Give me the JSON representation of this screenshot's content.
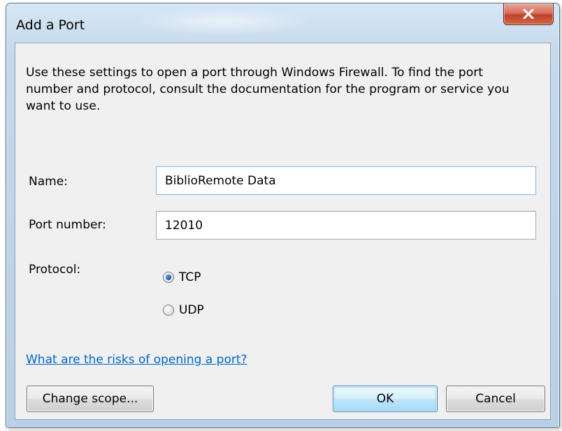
{
  "window": {
    "title": "Add a Port",
    "close_icon": "close-x-icon"
  },
  "dialog": {
    "description": "Use these settings to open a port through Windows Firewall. To find the port number and protocol, consult the documentation for the program or service you want to use.",
    "name_label": "Name:",
    "name_value": "BiblioRemote Data",
    "port_label": "Port number:",
    "port_value": "12010",
    "protocol_label": "Protocol:",
    "protocol_options": [
      {
        "label": "TCP",
        "selected": true
      },
      {
        "label": "UDP",
        "selected": false
      }
    ],
    "risk_link": "What are the risks of opening a port?",
    "change_scope_label": "Change scope...",
    "ok_label": "OK",
    "cancel_label": "Cancel"
  },
  "colors": {
    "link": "#0066cc",
    "close_button": "#c1412a",
    "client_bg": "#f0f0f0",
    "frame": "#b9cfe6"
  }
}
